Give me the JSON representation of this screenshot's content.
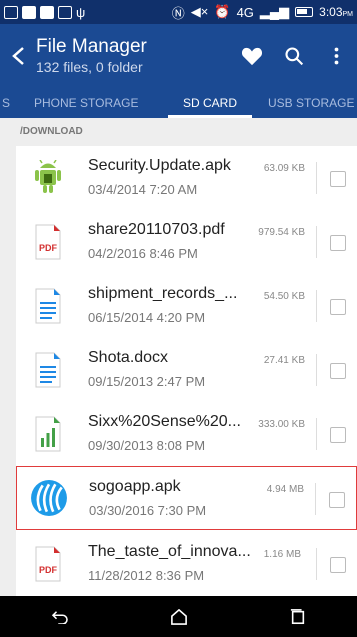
{
  "status_bar": {
    "time": "3:03",
    "time_suffix": "PM"
  },
  "app_bar": {
    "title": "File Manager",
    "subtitle": "132 files, 0 folder"
  },
  "tabs": [
    {
      "label": "S",
      "active": false
    },
    {
      "label": "PHONE STORAGE",
      "active": false
    },
    {
      "label": "SD CARD",
      "active": true
    },
    {
      "label": "USB STORAGE",
      "active": false
    }
  ],
  "path": "/DOWNLOAD",
  "files": [
    {
      "name": "Security.Update.apk",
      "date": "03/4/2014 7:20 AM",
      "size": "63.09 KB",
      "icon": "android-icon",
      "selected": false
    },
    {
      "name": "share20110703.pdf",
      "date": "04/2/2016 8:46 PM",
      "size": "979.54 KB",
      "icon": "pdf-icon",
      "selected": false
    },
    {
      "name": "shipment_records_...",
      "date": "06/15/2014 4:20 PM",
      "size": "54.50 KB",
      "icon": "document-icon",
      "selected": false
    },
    {
      "name": "Shota.docx",
      "date": "09/15/2013 2:47 PM",
      "size": "27.41 KB",
      "icon": "document-icon",
      "selected": false
    },
    {
      "name": "Sixx%20Sense%20...",
      "date": "09/30/2013 8:08 PM",
      "size": "333.00 KB",
      "icon": "spreadsheet-icon",
      "selected": false
    },
    {
      "name": "sogoapp.apk",
      "date": "03/30/2016 7:30 PM",
      "size": "4.94 MB",
      "icon": "sogo-app-icon",
      "selected": true
    },
    {
      "name": "The_taste_of_innova...",
      "date": "11/28/2012 8:36 PM",
      "size": "1.16 MB",
      "icon": "pdf-icon",
      "selected": false
    }
  ],
  "colors": {
    "app_bar": "#1b4a93",
    "status_bar": "#10306b",
    "selection_border": "#e03b3b"
  }
}
